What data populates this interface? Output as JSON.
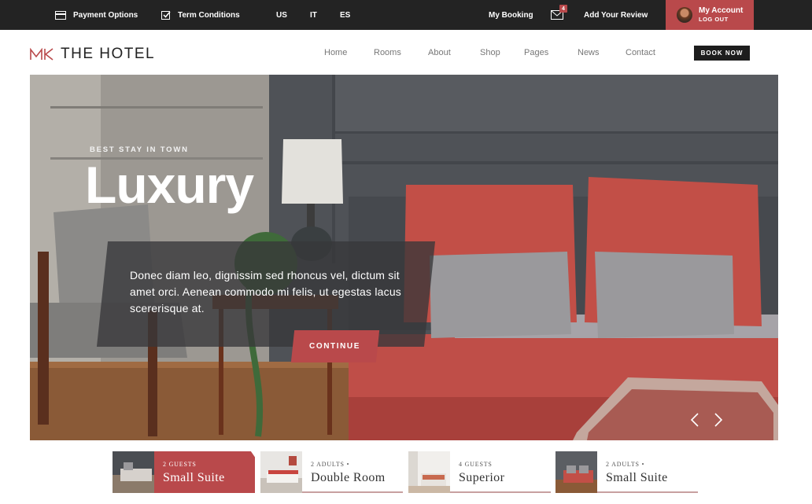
{
  "topbar": {
    "payment_label": "Payment Options",
    "terms_label": "Term Conditions",
    "languages": [
      "US",
      "IT",
      "ES"
    ],
    "booking_label": "My Booking",
    "mail_count": "4",
    "review_label": "Add Your Review",
    "account_title": "My Account",
    "account_sub": "LOG OUT"
  },
  "brand": {
    "mark": "MK",
    "name": "THE HOTEL"
  },
  "nav": {
    "items": [
      "Home",
      "Rooms",
      "About",
      "Shop",
      "Pages",
      "News",
      "Contact"
    ],
    "book_label": "BOOK NOW"
  },
  "hero": {
    "eyebrow": "BEST STAY IN TOWN",
    "title": "Luxury",
    "text": "Donec diam leo, dignissim sed rhoncus vel, dictum sit amet orci. Aenean commodo mi felis, ut egestas lacus scererisque at.",
    "cta": "CONTINUE"
  },
  "rooms": [
    {
      "line1": "2 GUESTS",
      "name": "Small Suite",
      "active": true
    },
    {
      "line1": "2 ADULTS •",
      "name": "Double Room",
      "active": false
    },
    {
      "line1": "4 GUESTS",
      "name": "Superior",
      "active": false
    },
    {
      "line1": "2 ADULTS •",
      "name": "Small Suite",
      "active": false
    }
  ],
  "colors": {
    "accent": "#b9494b",
    "topbar": "#232323",
    "dark_button": "#1d1d1d"
  }
}
